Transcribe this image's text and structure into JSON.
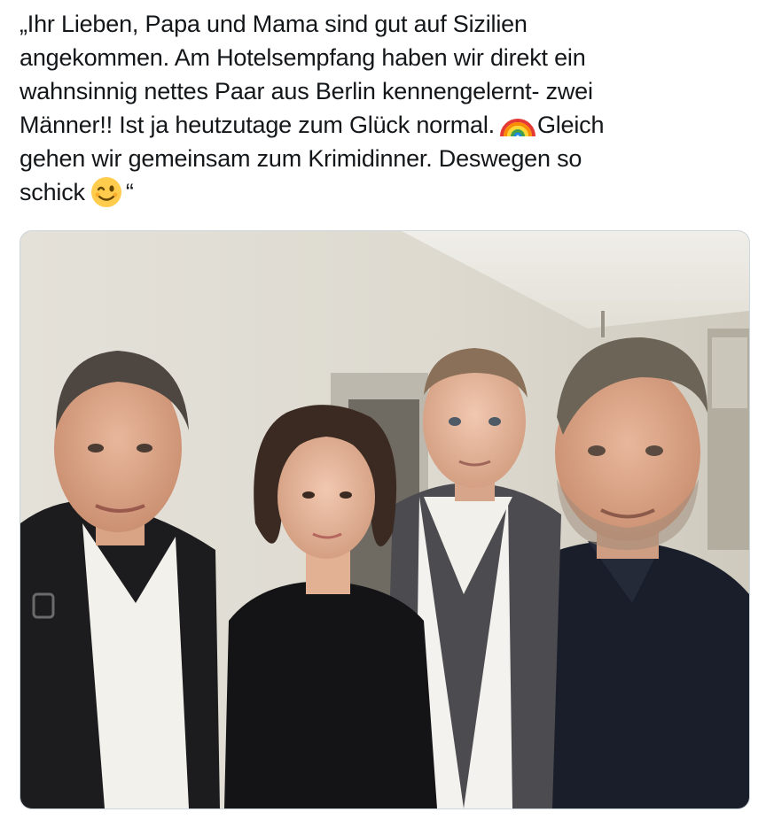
{
  "tweet": {
    "lines": [
      "„Ihr Lieben, Papa und Mama sind gut auf Sizilien",
      "angekommen. Am Hotelsempfang haben wir direkt ein",
      "wahnsinnig nettes Paar aus Berlin kennengelernt- zwei",
      "Männer!! Ist ja heutzutage zum Glück normal.",
      "Gleich",
      "gehen wir gemeinsam zum Krimidinner. Deswegen so",
      "schick",
      "“"
    ],
    "emojis": [
      "rainbow-emoji",
      "winking-face-emoji"
    ]
  },
  "media": {
    "kind": "photo",
    "subject_count": 4
  },
  "colors": {
    "text": "#14171a",
    "media_border": "#ccd6dd"
  }
}
